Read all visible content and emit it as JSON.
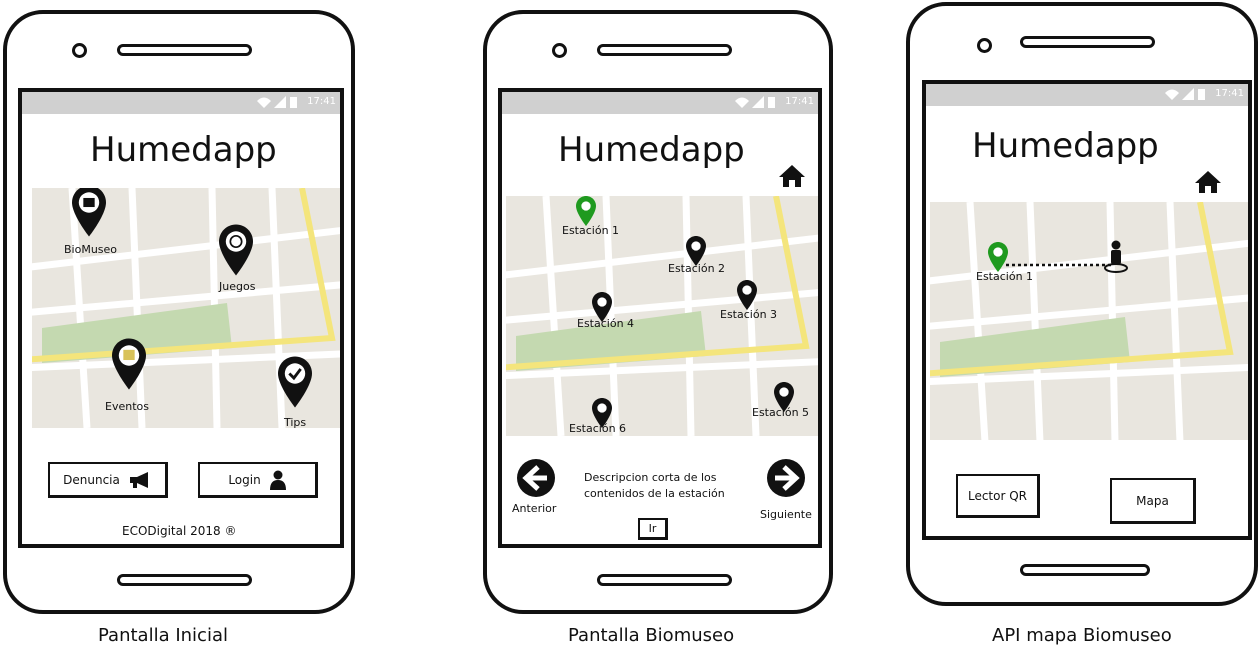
{
  "status": {
    "time": "17:41"
  },
  "screens": [
    {
      "title": "Humedapp",
      "caption": "Pantalla Inicial",
      "markers": [
        {
          "label": "BioMuseo",
          "icon": "museum-icon"
        },
        {
          "label": "Juegos",
          "icon": "basketball-icon"
        },
        {
          "label": "Eventos",
          "icon": "calendar-icon"
        },
        {
          "label": "Tips",
          "icon": "check-icon"
        }
      ],
      "buttons": {
        "denuncia": "Denuncia",
        "login": "Login"
      },
      "footer": "ECODigital 2018 ®"
    },
    {
      "title": "Humedapp",
      "caption": "Pantalla Biomuseo",
      "stations": [
        "Estación 1",
        "Estación 2",
        "Estación 3",
        "Estación 4",
        "Estación 5",
        "Estación 6"
      ],
      "description": [
        "Descripcion corta de los",
        "contenidos de la estación"
      ],
      "prev_label": "Anterior",
      "next_label": "Siguiente",
      "go_label": "Ir"
    },
    {
      "title": "Humedapp",
      "caption": "API mapa Biomuseo",
      "station": "Estación 1",
      "buttons": {
        "qr": "Lector QR",
        "map": "Mapa"
      }
    }
  ],
  "colors": {
    "status_bar": "#d0d0d0",
    "map_bg": "#e9e6df",
    "park": "#c4d9b0",
    "road_yellow": "#f4e57c",
    "marker_green": "#1f9a1f"
  }
}
